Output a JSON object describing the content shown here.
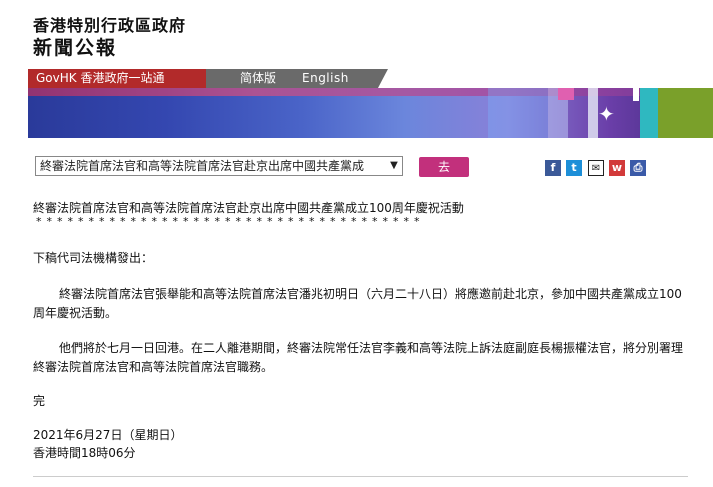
{
  "header": {
    "title": "香港特別行政區政府",
    "subtitle": "新聞公報"
  },
  "nav": {
    "govhk": "GovHK 香港政府一站通",
    "simplified": "简体版",
    "english": "English"
  },
  "select": {
    "value": "終審法院首席法官和高等法院首席法官赴京出席中國共產黨成",
    "go_label": "去"
  },
  "share": {
    "facebook": "f",
    "twitter": "t",
    "mail": "✉",
    "weibo": "w",
    "print": "⎙"
  },
  "article": {
    "title": "終審法院首席法官和高等法院首席法官赴京出席中國共產黨成立100周年慶祝活動",
    "stars": "*************************************",
    "p0": "下稿代司法機構發出：",
    "p1": "終審法院首席法官張舉能和高等法院首席法官潘兆初明日（六月二十八日）將應邀前赴北京，參加中國共產黨成立100周年慶祝活動。",
    "p2": "他們將於七月一日回港。在二人離港期間，終審法院常任法官李義和高等法院上訴法庭副庭長楊振權法官，將分別署理終審法院首席法官和高等法院首席法官職務。",
    "end": "完",
    "date": "2021年6月27日（星期日）",
    "time": "香港時間18時06分"
  }
}
